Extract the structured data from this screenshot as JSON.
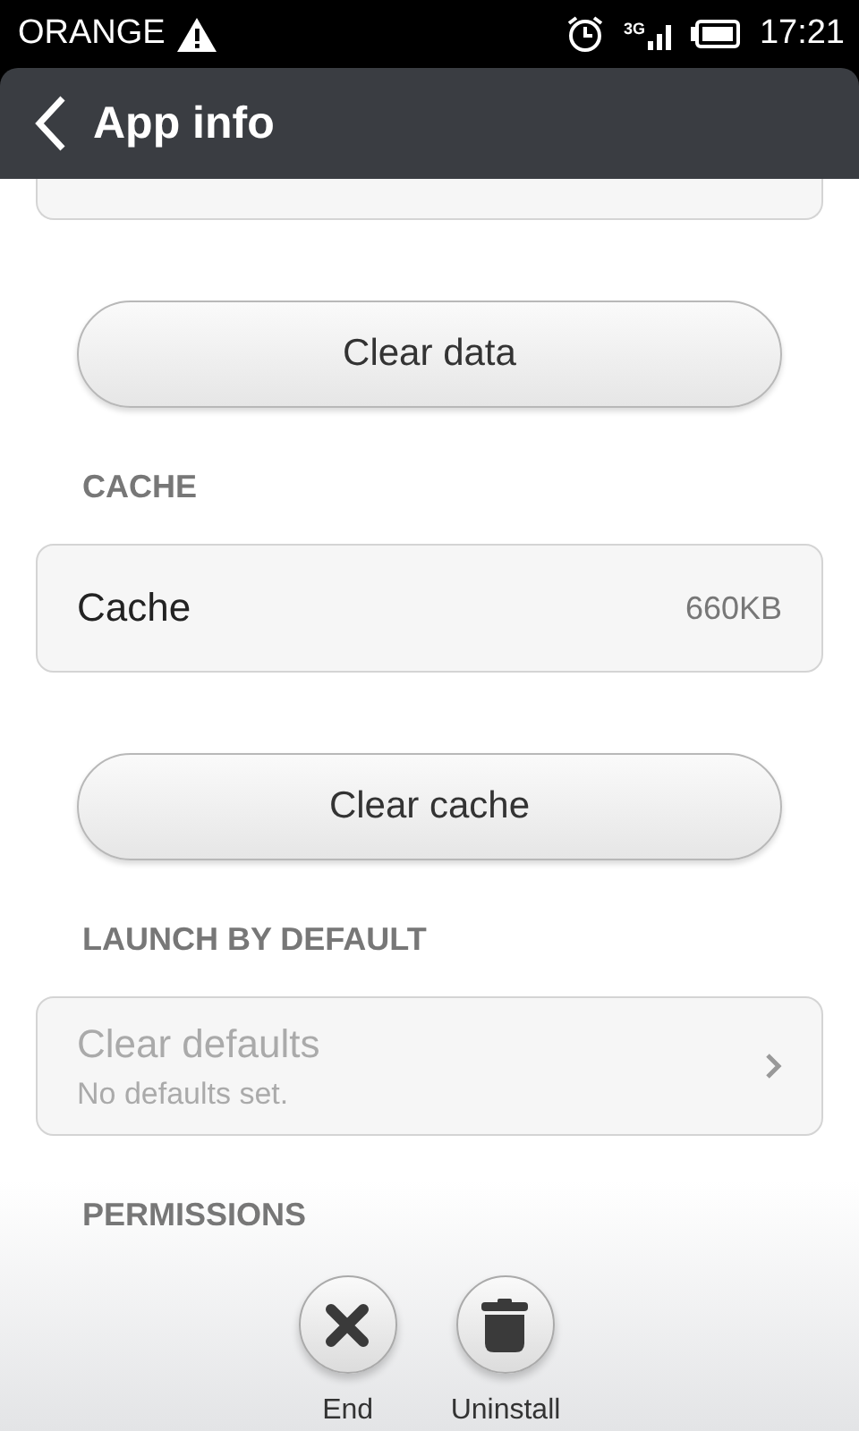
{
  "status_bar": {
    "carrier": "ORANGE",
    "network": "3G",
    "time": "17:21"
  },
  "app_bar": {
    "title": "App info"
  },
  "sections": [
    {
      "kind": "partial-card"
    },
    {
      "kind": "button",
      "label": "Clear data"
    },
    {
      "kind": "header",
      "label": "CACHE"
    },
    {
      "kind": "info-row",
      "label": "Cache",
      "value": "660KB"
    },
    {
      "kind": "button",
      "label": "Clear cache"
    },
    {
      "kind": "header",
      "label": "LAUNCH BY DEFAULT"
    },
    {
      "kind": "nav-row",
      "label": "Clear defaults",
      "subtitle": "No defaults set.",
      "disabled": true
    },
    {
      "kind": "header",
      "label": "PERMISSIONS"
    }
  ],
  "actions": [
    {
      "kind": "end",
      "label": "End"
    },
    {
      "kind": "uninstall",
      "label": "Uninstall"
    }
  ]
}
